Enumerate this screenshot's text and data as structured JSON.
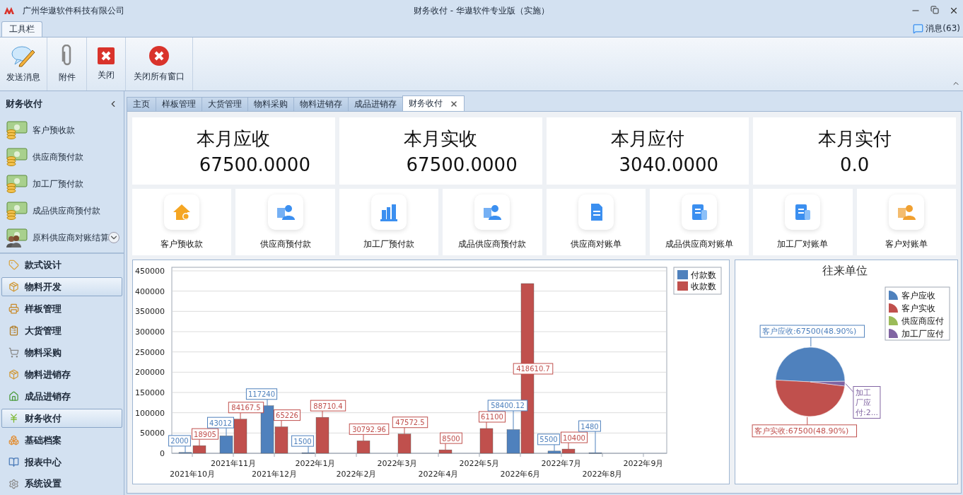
{
  "window": {
    "company": "广州华遨软件科技有限公司",
    "title": "财务收付 - 华遨软件专业版（实施）"
  },
  "ribbon": {
    "tabs": [
      {
        "label": "工具栏",
        "selected": true
      }
    ],
    "messages": "消息(63)",
    "buttons": [
      {
        "label": "发送消息",
        "kind": "message"
      },
      {
        "label": "附件",
        "kind": "attach"
      },
      {
        "label": "关闭",
        "kind": "close"
      },
      {
        "label": "关闭所有窗口",
        "kind": "close_all"
      }
    ]
  },
  "sidebar": {
    "title": "财务收付",
    "items": [
      {
        "label": "客户预收款",
        "kind": "money"
      },
      {
        "label": "供应商预付款",
        "kind": "money"
      },
      {
        "label": "加工厂预付款",
        "kind": "money"
      },
      {
        "label": "成品供应商预付款",
        "kind": "money"
      },
      {
        "label": "原料供应商对账结算",
        "kind": "people"
      }
    ],
    "nav": [
      {
        "label": "款式设计",
        "selected": false
      },
      {
        "label": "物料开发",
        "selected": true
      },
      {
        "label": "样板管理",
        "selected": false
      },
      {
        "label": "大货管理",
        "selected": false
      },
      {
        "label": "物料采购",
        "selected": false
      },
      {
        "label": "物料进销存",
        "selected": false
      },
      {
        "label": "成品进销存",
        "selected": false
      },
      {
        "label": "财务收付",
        "selected": true
      },
      {
        "label": "基础档案",
        "selected": false
      },
      {
        "label": "报表中心",
        "selected": false
      },
      {
        "label": "系统设置",
        "selected": false
      }
    ]
  },
  "tabs": [
    {
      "label": "主页",
      "selected": false
    },
    {
      "label": "样板管理",
      "selected": false
    },
    {
      "label": "大货管理",
      "selected": false
    },
    {
      "label": "物料采购",
      "selected": false
    },
    {
      "label": "物料进销存",
      "selected": false
    },
    {
      "label": "成品进销存",
      "selected": false
    },
    {
      "label": "财务收付",
      "selected": true,
      "closable": true
    }
  ],
  "stats": [
    {
      "label": "本月应收",
      "value": "67500.0000"
    },
    {
      "label": "本月实收",
      "value": "67500.0000"
    },
    {
      "label": "本月应付",
      "value": "3040.0000"
    },
    {
      "label": "本月实付",
      "value": "0.0"
    }
  ],
  "shortcuts": [
    {
      "label": "客户预收款",
      "kind": "house"
    },
    {
      "label": "供应商预付款",
      "kind": "person"
    },
    {
      "label": "加工厂预付款",
      "kind": "factory"
    },
    {
      "label": "成品供应商预付款",
      "kind": "person"
    },
    {
      "label": "供应商对账单",
      "kind": "doc"
    },
    {
      "label": "成品供应商对账单",
      "kind": "doccard"
    },
    {
      "label": "加工厂对账单",
      "kind": "doccard"
    },
    {
      "label": "客户对账单",
      "kind": "person_orange"
    }
  ],
  "bar_chart": {
    "chart_data": {
      "type": "bar",
      "categories": [
        "2021年10月",
        "2021年11月",
        "2021年12月",
        "2022年1月",
        "2022年2月",
        "2022年3月",
        "2022年4月",
        "2022年5月",
        "2022年6月",
        "2022年7月",
        "2022年8月",
        "2022年9月"
      ],
      "series": [
        {
          "name": "付款数",
          "color": "#4f81bd",
          "values": [
            2000,
            43012,
            117240,
            1500,
            null,
            null,
            null,
            null,
            58400.12,
            5500,
            1480,
            null
          ]
        },
        {
          "name": "收款数",
          "color": "#c0504d",
          "values": [
            18905,
            84167.5,
            65226,
            88710.4,
            30792.96,
            47572.5,
            8500,
            61100,
            418610.7,
            10400,
            null,
            null
          ]
        }
      ],
      "ylim": [
        0,
        450000
      ],
      "yticks": [
        0,
        50000,
        100000,
        150000,
        200000,
        250000,
        300000,
        350000,
        400000,
        450000
      ],
      "data_labels": true,
      "grid": true,
      "legend": "right"
    }
  },
  "pie_chart": {
    "chart_data": {
      "type": "pie",
      "title": "往来单位",
      "categories": [
        "客户应收",
        "客户实收",
        "供应商应付",
        "加工厂应付"
      ],
      "values": [
        48.9,
        48.9,
        0,
        2.2
      ],
      "colors": [
        "#4f81bd",
        "#c0504d",
        "#9bbb59",
        "#8064a2"
      ],
      "value_labels": [
        "客户应收:67500(48.90%)",
        "客户实收:67500(48.90%)",
        null,
        "加工厂应付:2..."
      ],
      "legend": "top-right"
    }
  }
}
